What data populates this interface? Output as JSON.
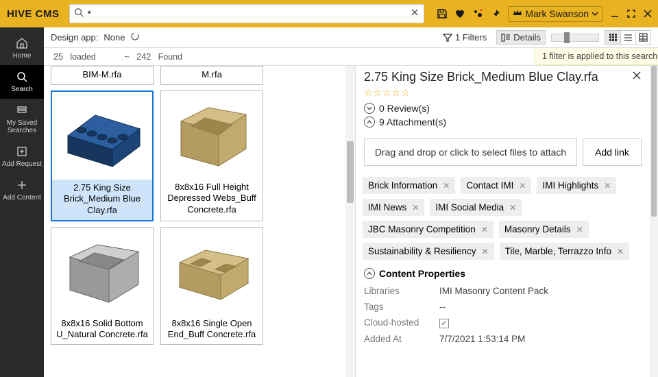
{
  "brand": "HIVE CMS",
  "search": {
    "placeholder": "",
    "value": "*"
  },
  "user": {
    "name": "Mark Swanson"
  },
  "nav": {
    "home": "Home",
    "search": "Search",
    "saved": "My Saved Searches",
    "addreq": "Add Request",
    "addcontent": "Add Content"
  },
  "toolbar": {
    "design_label": "Design app:",
    "design_value": "None",
    "filters_label": "1 Filters",
    "details_label": "Details"
  },
  "status": {
    "loaded_n": "25",
    "loaded_t": "loaded",
    "approx": "~",
    "found_n": "242",
    "found_t": "Found",
    "filter_banner": "1 filter is applied to this search"
  },
  "cards": [
    {
      "title": "BIM-M.rfa"
    },
    {
      "title": "M.rfa"
    },
    {
      "title": "2.75 King Size Brick_Medium Blue Clay.rfa"
    },
    {
      "title": "8x8x16 Full Height Depressed Webs_Buff Concrete.rfa"
    },
    {
      "title": "8x8x16 Solid Bottom U_Natural Concrete.rfa"
    },
    {
      "title": "8x8x16 Single Open End_Buff Concrete.rfa"
    }
  ],
  "detail": {
    "title": "2.75 King Size Brick_Medium Blue Clay.rfa",
    "reviews": "0 Review(s)",
    "attachments": "9 Attachment(s)",
    "dropzone": "Drag and drop or click to select files to attach",
    "addlink": "Add link",
    "tags": [
      "Brick Information",
      "Contact IMI",
      "IMI Highlights",
      "IMI News",
      "IMI Social Media",
      "JBC Masonry Competition",
      "Masonry Details",
      "Sustainability & Resiliency",
      "Tile, Marble, Terrazzo Info"
    ],
    "props_header": "Content Properties",
    "props": {
      "libraries_k": "Libraries",
      "libraries_v": "IMI Masonry Content Pack",
      "tags_k": "Tags",
      "tags_v": "--",
      "cloud_k": "Cloud-hosted",
      "added_k": "Added At",
      "added_v": "7/7/2021 1:53:14 PM"
    }
  }
}
